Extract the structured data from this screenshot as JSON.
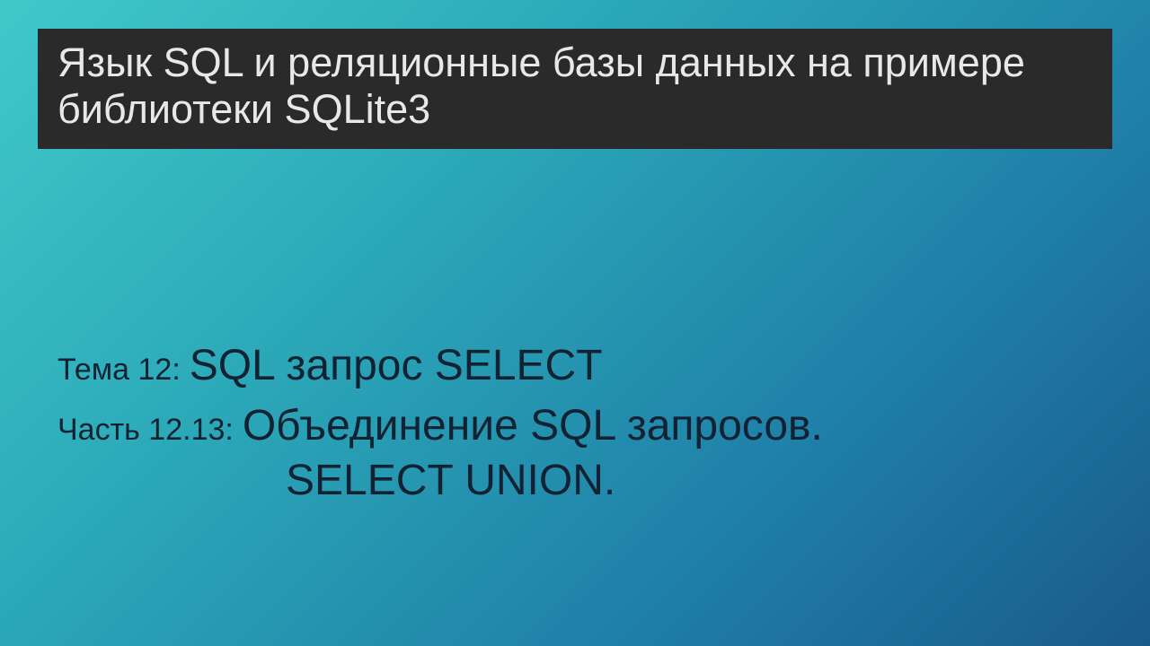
{
  "title": "Язык SQL и реляционные базы данных на примере библиотеки SQLite3",
  "theme": {
    "label": "Тема 12:",
    "value": "SQL запрос SELECT"
  },
  "part": {
    "label": "Часть 12.13:",
    "value": "Объединение SQL запросов.",
    "value2": "SELECT UNION."
  }
}
